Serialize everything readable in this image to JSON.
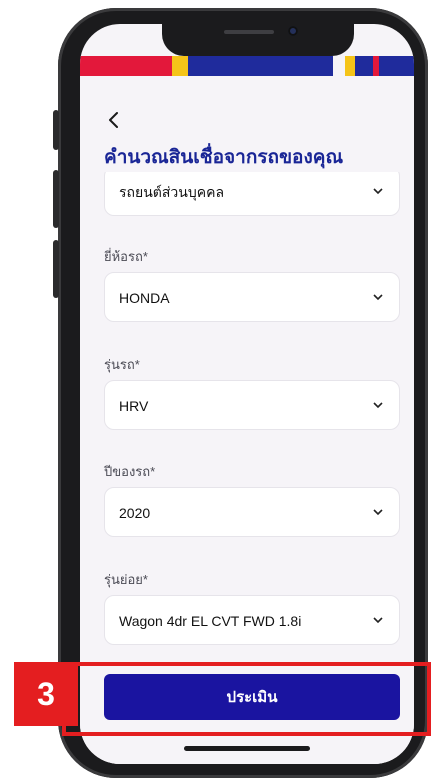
{
  "header": {
    "back_icon": "chevron-left-icon",
    "title": "คำนวณสินเชื่อจากรถของคุณ"
  },
  "form": {
    "fields": [
      {
        "label": "",
        "value": "รถยนต์ส่วนบุคคล"
      },
      {
        "label": "ยี่ห้อรถ*",
        "value": "HONDA"
      },
      {
        "label": "รุ่นรถ*",
        "value": "HRV"
      },
      {
        "label": "ปีของรถ*",
        "value": "2020"
      },
      {
        "label": "รุ่นย่อย*",
        "value": "Wagon 4dr EL CVT FWD 1.8i"
      }
    ],
    "dropdown_icon": "chevron-down-icon"
  },
  "actions": {
    "submit_label": "ประเมิน"
  },
  "annotation": {
    "step_number": "3"
  },
  "colors": {
    "brand_blue": "#1a14a0",
    "title_blue": "#1a2696",
    "annotation_red": "#e41e20",
    "stripe_red": "#e3183b",
    "stripe_yellow": "#f5c419",
    "stripe_blue": "#1f2b9c"
  }
}
